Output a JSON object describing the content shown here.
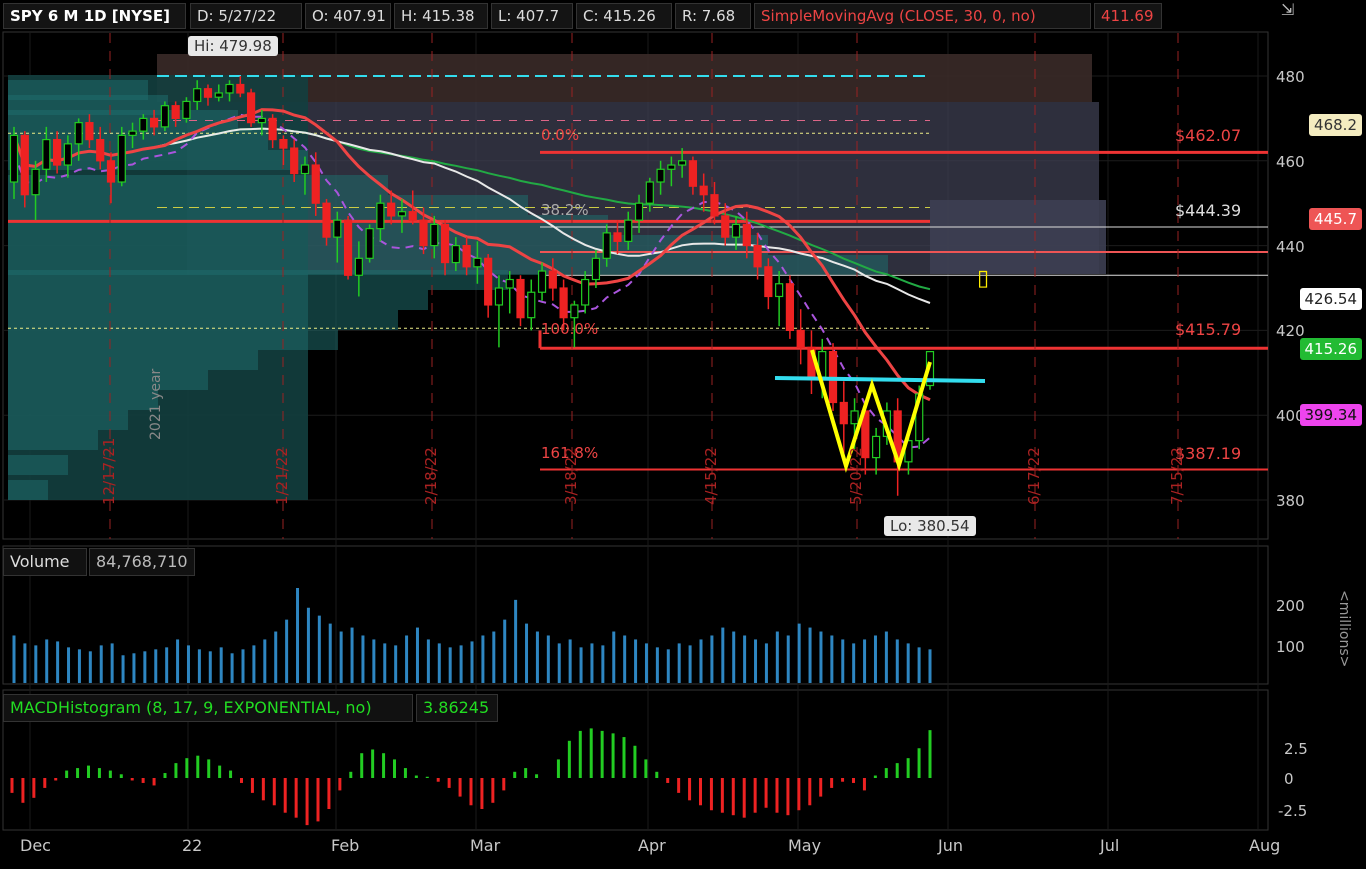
{
  "header": {
    "symbol": "SPY 6 M 1D [NYSE]",
    "date": "D: 5/27/22",
    "open": "O: 407.91",
    "high": "H: 415.38",
    "low": "L: 407.7",
    "close": "C: 415.26",
    "range": "R: 7.68",
    "study": "SimpleMovingAvg (CLOSE, 30, 0, no)",
    "study_value": "411.69"
  },
  "annotations": {
    "hi": "Hi: 479.98",
    "lo": "Lo: 380.54",
    "fib_0": "0.0%",
    "fib_382": "38.2%",
    "fib_100": "100.0%",
    "fib_1618": "161.8%",
    "lvl_462": "$462.07",
    "lvl_444": "$444.39",
    "lvl_415": "$415.79",
    "lvl_387": "$387.19",
    "year_mark": "2021 year"
  },
  "price_tags": {
    "t468": "468.2",
    "t445": "445.7",
    "t426": "426.54",
    "t415": "415.26",
    "t399": "399.34"
  },
  "vertical_dates": [
    "12/17/21",
    "1/21/22",
    "2/18/22",
    "3/18/22",
    "4/15/22",
    "5/20/22",
    "6/17/22",
    "7/15/22"
  ],
  "volume_panel": {
    "title": "Volume",
    "value": "84,768,710",
    "unit": "<millions>"
  },
  "macd_panel": {
    "title": "MACDHistogram (8, 17, 9, EXPONENTIAL, no)",
    "value": "3.86245"
  },
  "colors": {
    "up": "#22cc22",
    "down": "#ee2222",
    "sma_red": "#ee4444",
    "sma_white": "#e8e8e8",
    "volume": "#2e86c1",
    "w_pattern": "#ffff00",
    "neckline": "#33ddee"
  },
  "chart_data": [
    {
      "type": "candlestick",
      "title": "SPY 6 M 1D [NYSE]",
      "ylim": [
        370,
        490
      ],
      "y_ticks": [
        380,
        400,
        420,
        440,
        460,
        480
      ],
      "x_ticks": [
        "Dec",
        "22",
        "Feb",
        "Mar",
        "Apr",
        "May",
        "Jun",
        "Jul",
        "Aug"
      ],
      "grid": true,
      "ohlc": [
        [
          455,
          468,
          451,
          466
        ],
        [
          466,
          467,
          449,
          452
        ],
        [
          452,
          460,
          446,
          458
        ],
        [
          458,
          468,
          455,
          465
        ],
        [
          465,
          467,
          457,
          459
        ],
        [
          459,
          466,
          456,
          464
        ],
        [
          464,
          470,
          460,
          469
        ],
        [
          469,
          471,
          463,
          465
        ],
        [
          465,
          468,
          458,
          460
        ],
        [
          460,
          462,
          450,
          455
        ],
        [
          455,
          468,
          454,
          466
        ],
        [
          466,
          469,
          463,
          467
        ],
        [
          467,
          471,
          465,
          470
        ],
        [
          470,
          472,
          466,
          468
        ],
        [
          468,
          474,
          467,
          473
        ],
        [
          473,
          474,
          468,
          470
        ],
        [
          470,
          475,
          469,
          474
        ],
        [
          474,
          479,
          472,
          477
        ],
        [
          477,
          478,
          473,
          475
        ],
        [
          475,
          478,
          474,
          476
        ],
        [
          476,
          479,
          474,
          478
        ],
        [
          478,
          480,
          475,
          476
        ],
        [
          476,
          477,
          468,
          469
        ],
        [
          469,
          472,
          466,
          470
        ],
        [
          470,
          471,
          463,
          465
        ],
        [
          465,
          466,
          459,
          463
        ],
        [
          463,
          465,
          455,
          457
        ],
        [
          457,
          461,
          452,
          459
        ],
        [
          459,
          462,
          447,
          450
        ],
        [
          450,
          451,
          440,
          442
        ],
        [
          442,
          448,
          436,
          446
        ],
        [
          446,
          447,
          432,
          433
        ],
        [
          433,
          441,
          428,
          437
        ],
        [
          437,
          445,
          436,
          444
        ],
        [
          444,
          452,
          441,
          450
        ],
        [
          450,
          453,
          445,
          447
        ],
        [
          447,
          451,
          443,
          448
        ],
        [
          448,
          453,
          445,
          446
        ],
        [
          446,
          449,
          438,
          440
        ],
        [
          440,
          447,
          437,
          445
        ],
        [
          445,
          446,
          433,
          436
        ],
        [
          436,
          442,
          434,
          440
        ],
        [
          440,
          442,
          433,
          435
        ],
        [
          435,
          441,
          431,
          437
        ],
        [
          437,
          438,
          423,
          426
        ],
        [
          426,
          433,
          416,
          430
        ],
        [
          430,
          434,
          424,
          432
        ],
        [
          432,
          433,
          421,
          423
        ],
        [
          423,
          432,
          420,
          429
        ],
        [
          429,
          436,
          427,
          434
        ],
        [
          434,
          437,
          427,
          430
        ],
        [
          430,
          432,
          420,
          423
        ],
        [
          423,
          427,
          416,
          426
        ],
        [
          426,
          434,
          424,
          432
        ],
        [
          432,
          439,
          430,
          437
        ],
        [
          437,
          445,
          435,
          443
        ],
        [
          443,
          446,
          438,
          441
        ],
        [
          441,
          448,
          439,
          446
        ],
        [
          446,
          452,
          443,
          450
        ],
        [
          450,
          456,
          448,
          455
        ],
        [
          455,
          460,
          452,
          458
        ],
        [
          458,
          461,
          454,
          459
        ],
        [
          459,
          463,
          456,
          460
        ],
        [
          460,
          461,
          452,
          454
        ],
        [
          454,
          457,
          448,
          452
        ],
        [
          452,
          455,
          445,
          447
        ],
        [
          447,
          450,
          440,
          442
        ],
        [
          442,
          447,
          439,
          445
        ],
        [
          445,
          448,
          437,
          440
        ],
        [
          440,
          443,
          432,
          435
        ],
        [
          435,
          437,
          425,
          428
        ],
        [
          428,
          434,
          421,
          431
        ],
        [
          431,
          433,
          418,
          420
        ],
        [
          420,
          425,
          412,
          416
        ],
        [
          416,
          420,
          405,
          409
        ],
        [
          409,
          418,
          404,
          415
        ],
        [
          415,
          417,
          401,
          403
        ],
        [
          403,
          408,
          391,
          398
        ],
        [
          398,
          404,
          392,
          401
        ],
        [
          401,
          403,
          386,
          390
        ],
        [
          390,
          397,
          386,
          395
        ],
        [
          395,
          403,
          393,
          401
        ],
        [
          401,
          404,
          381,
          389
        ],
        [
          389,
          395,
          386,
          394
        ],
        [
          394,
          407,
          392,
          405
        ],
        [
          407,
          415,
          406,
          415
        ]
      ],
      "volume_millions": [
        120,
        100,
        95,
        110,
        105,
        90,
        85,
        80,
        95,
        100,
        70,
        75,
        80,
        85,
        90,
        110,
        95,
        85,
        80,
        90,
        75,
        85,
        95,
        110,
        130,
        160,
        240,
        190,
        170,
        150,
        130,
        140,
        120,
        110,
        100,
        95,
        120,
        140,
        110,
        100,
        90,
        95,
        105,
        120,
        130,
        160,
        210,
        150,
        130,
        120,
        100,
        110,
        90,
        100,
        95,
        130,
        120,
        110,
        100,
        90,
        85,
        100,
        95,
        110,
        120,
        140,
        130,
        120,
        110,
        100,
        130,
        120,
        150,
        140,
        130,
        120,
        110,
        100,
        110,
        120,
        130,
        110,
        100,
        90,
        85
      ],
      "macd_hist": [
        -1.2,
        -2.0,
        -1.6,
        -0.8,
        -0.2,
        0.6,
        0.8,
        1.0,
        0.8,
        0.6,
        0.3,
        -0.2,
        -0.4,
        -0.6,
        0.4,
        1.2,
        1.6,
        1.8,
        1.5,
        1.0,
        0.6,
        -0.4,
        -1.2,
        -1.8,
        -2.2,
        -2.8,
        -3.2,
        -3.8,
        -3.5,
        -2.5,
        -1.0,
        0.5,
        2.0,
        2.3,
        2.0,
        1.5,
        0.8,
        0.2,
        0.1,
        -0.3,
        -0.8,
        -1.5,
        -2.2,
        -2.5,
        -2.0,
        -1.0,
        0.5,
        0.8,
        0.3,
        0.0,
        1.5,
        3.0,
        3.8,
        4.0,
        3.8,
        3.6,
        3.3,
        2.6,
        1.5,
        0.5,
        -0.4,
        -1.2,
        -1.8,
        -2.2,
        -2.6,
        -2.8,
        -3.0,
        -3.2,
        -2.8,
        -2.4,
        -2.8,
        -3.0,
        -2.6,
        -2.2,
        -1.5,
        -0.8,
        -0.3,
        -0.4,
        -1.0,
        0.2,
        0.8,
        1.2,
        1.6,
        2.4,
        3.86
      ],
      "macd_ylim": [
        -3.8,
        4.2
      ],
      "volume_ylim": [
        0,
        250
      ],
      "volume_ticks": [
        100,
        200
      ],
      "macd_ticks": [
        2.5,
        0,
        -2.5
      ]
    }
  ]
}
